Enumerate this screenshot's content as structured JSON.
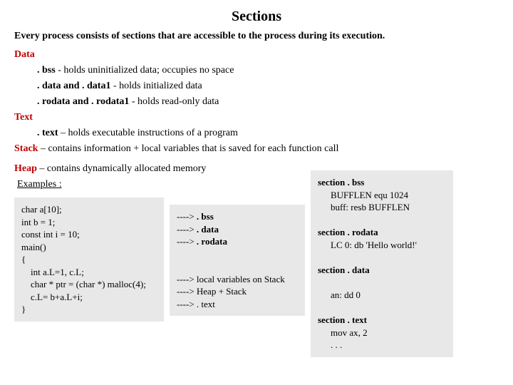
{
  "title": "Sections",
  "intro": "Every process consists of sections that are accessible to the process during its execution.",
  "data": {
    "label": "Data",
    "bss": {
      "name": ". bss",
      "desc": " - holds uninitialized data; occupies no space"
    },
    "datasec": {
      "name": ". data and . data1",
      "desc": " - holds initialized data"
    },
    "rodata": {
      "name": ". rodata and . rodata1",
      "desc": " - holds read-only data"
    }
  },
  "text": {
    "label": "Text",
    "textsec": {
      "name": ". text",
      "desc": " – holds executable instructions of a program"
    }
  },
  "stack": {
    "label": "Stack",
    "desc": " – contains  information + local variables that is saved for each function call"
  },
  "heap": {
    "label": "Heap",
    "desc": " – contains dynamically allocated memory"
  },
  "examples_label": "Examples :",
  "code_left": {
    "l1": "char a[10];",
    "l2": "int b = 1;",
    "l3": "const int i = 10;",
    "l4": "main()",
    "l5": "{",
    "l6": "    int a.L=1, c.L;",
    "l7": "    char * ptr = (char *) malloc(4);",
    "l8": "    c.L= b+a.L+i;",
    "l9": "}"
  },
  "code_mid": {
    "m1a": "---->",
    "m1b": " . bss",
    "m2a": " ---->",
    "m2b": " . data",
    "m3a": " ---->",
    "m3b": " . rodata",
    "m4": " ",
    "m5": " ",
    "m6": "----> local variables on Stack",
    "m7": "----> Heap + Stack",
    "m8": "----> . text"
  },
  "asm": {
    "s1": "section . bss",
    "s1a": "BUFFLEN equ 1024",
    "s1b": "buff: resb BUFFLEN",
    "sp1": " ",
    "s2": "section . rodata",
    "s2a": "LC 0: db 'Hello world!'",
    "sp2": " ",
    "s3": "section . data",
    "sp3": " ",
    "s3a": "an: dd 0",
    "sp4": " ",
    "s4": "section . text",
    "s4a": "mov ax, 2",
    "s4b": ". . ."
  }
}
